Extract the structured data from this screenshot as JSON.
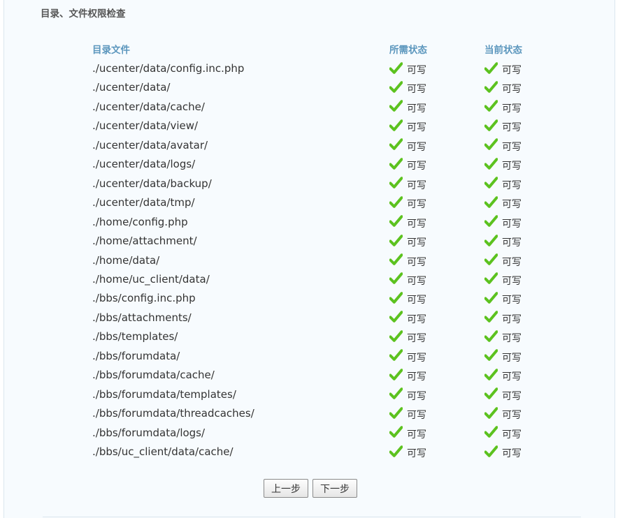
{
  "section_title": "目录、文件权限检查",
  "table": {
    "headers": {
      "path": "目录文件",
      "required": "所需状态",
      "current": "当前状态"
    },
    "rows": [
      {
        "path": "./ucenter/data/config.inc.php",
        "required": "可写",
        "current": "可写"
      },
      {
        "path": "./ucenter/data/",
        "required": "可写",
        "current": "可写"
      },
      {
        "path": "./ucenter/data/cache/",
        "required": "可写",
        "current": "可写"
      },
      {
        "path": "./ucenter/data/view/",
        "required": "可写",
        "current": "可写"
      },
      {
        "path": "./ucenter/data/avatar/",
        "required": "可写",
        "current": "可写"
      },
      {
        "path": "./ucenter/data/logs/",
        "required": "可写",
        "current": "可写"
      },
      {
        "path": "./ucenter/data/backup/",
        "required": "可写",
        "current": "可写"
      },
      {
        "path": "./ucenter/data/tmp/",
        "required": "可写",
        "current": "可写"
      },
      {
        "path": "./home/config.php",
        "required": "可写",
        "current": "可写"
      },
      {
        "path": "./home/attachment/",
        "required": "可写",
        "current": "可写"
      },
      {
        "path": "./home/data/",
        "required": "可写",
        "current": "可写"
      },
      {
        "path": "./home/uc_client/data/",
        "required": "可写",
        "current": "可写"
      },
      {
        "path": "./bbs/config.inc.php",
        "required": "可写",
        "current": "可写"
      },
      {
        "path": "./bbs/attachments/",
        "required": "可写",
        "current": "可写"
      },
      {
        "path": "./bbs/templates/",
        "required": "可写",
        "current": "可写"
      },
      {
        "path": "./bbs/forumdata/",
        "required": "可写",
        "current": "可写"
      },
      {
        "path": "./bbs/forumdata/cache/",
        "required": "可写",
        "current": "可写"
      },
      {
        "path": "./bbs/forumdata/templates/",
        "required": "可写",
        "current": "可写"
      },
      {
        "path": "./bbs/forumdata/threadcaches/",
        "required": "可写",
        "current": "可写"
      },
      {
        "path": "./bbs/forumdata/logs/",
        "required": "可写",
        "current": "可写"
      },
      {
        "path": "./bbs/uc_client/data/cache/",
        "required": "可写",
        "current": "可写"
      }
    ]
  },
  "buttons": {
    "prev_label": "上一步",
    "next_label": "下一步"
  },
  "icons": {
    "status_ok": "check-icon"
  },
  "colors": {
    "header_text": "#5b96bd",
    "check_green": "#5cc21f",
    "panel_bg": "#f7fbfe"
  }
}
